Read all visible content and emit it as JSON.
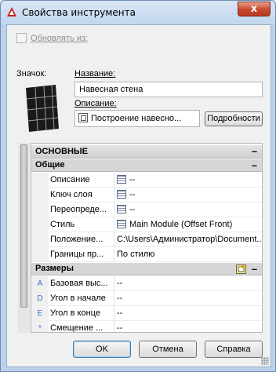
{
  "window": {
    "title": "Свойства инструмента",
    "close_label": "x"
  },
  "update_from": {
    "label": "Обновлять из:",
    "checked": false
  },
  "icon_label": "Значок:",
  "name": {
    "label": "Название:",
    "value": "Навесная стена"
  },
  "description": {
    "label": "Описание:",
    "value": "Построение навесно...",
    "details_button": "Подробности"
  },
  "grid": {
    "main_section": "ОСНОВНЫЕ",
    "general_category": "Общие",
    "general_rows": [
      {
        "name": "Описание",
        "value": "--",
        "icon": "table-icon"
      },
      {
        "name": "Ключ слоя",
        "value": "--",
        "icon": "table-icon"
      },
      {
        "name": "Переопреде...",
        "value": "--",
        "icon": "table-icon"
      },
      {
        "name": "Стиль",
        "value": "Main Module (Offset Front)",
        "icon": "style-icon"
      },
      {
        "name": "Положение...",
        "value": "C:\\Users\\Администратор\\Document..."
      },
      {
        "name": "Границы пр...",
        "value": "По стилю"
      }
    ],
    "dimensions_category": "Размеры",
    "dimension_rows": [
      {
        "marker": "A",
        "name": "Базовая выс...",
        "value": "--"
      },
      {
        "marker": "D",
        "name": "Угол в начале",
        "value": "--"
      },
      {
        "marker": "E",
        "name": "Угол в конце",
        "value": "--"
      },
      {
        "marker": "*",
        "name": "Смещение ...",
        "value": "--"
      }
    ],
    "collapse_symbol": "–"
  },
  "buttons": {
    "ok": "OK",
    "cancel": "Отмена",
    "help": "Справка"
  },
  "colors": {
    "title_bar": "#c2d6ee",
    "close_button": "#c7482d",
    "section_header": "#d6d6d6",
    "marker_blue": "#3a6fc4"
  }
}
